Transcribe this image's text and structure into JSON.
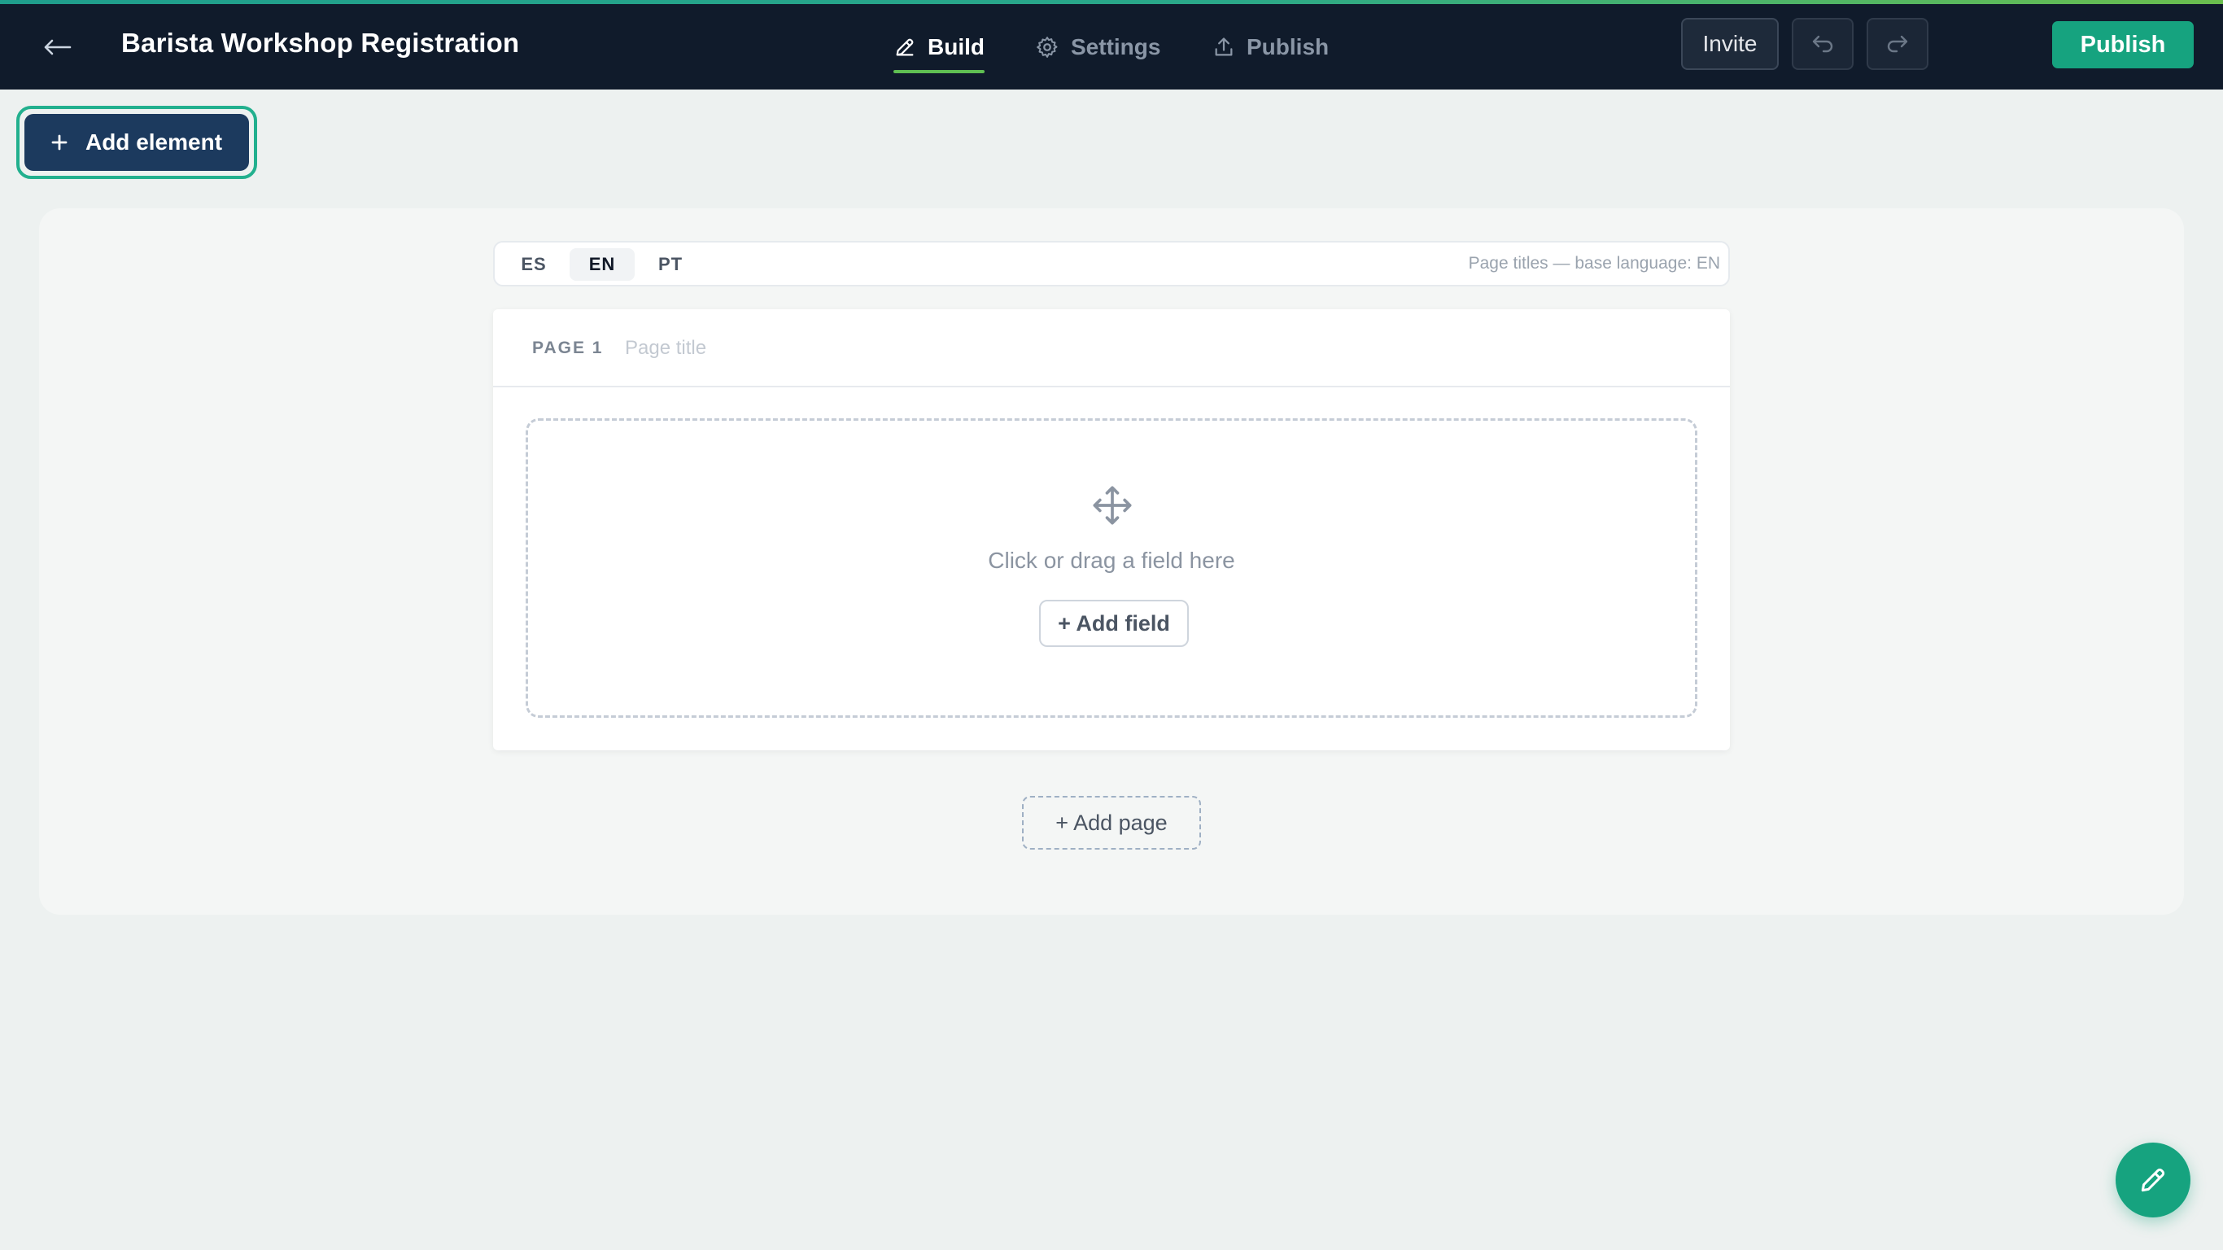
{
  "header": {
    "title": "Barista Workshop Registration",
    "tabs": [
      {
        "label": "Build",
        "icon": "pencil-icon",
        "active": true
      },
      {
        "label": "Settings",
        "icon": "gear-icon",
        "active": false
      },
      {
        "label": "Publish",
        "icon": "upload-icon",
        "active": false
      }
    ],
    "invite_label": "Invite",
    "publish_label": "Publish"
  },
  "toolbar": {
    "add_element_label": "Add element"
  },
  "languages": {
    "options": [
      "ES",
      "EN",
      "PT"
    ],
    "selected": "EN",
    "note": "Page titles — base language: EN"
  },
  "page": {
    "label": "PAGE 1",
    "title_value": "",
    "title_placeholder": "Page title",
    "dropzone_text": "Click or drag a field here",
    "add_field_label": "+ Add field"
  },
  "add_page_label": "+ Add page",
  "colors": {
    "header_bg": "#101b2b",
    "accent_green": "#16a37f",
    "active_tab_underline": "#5fbf52",
    "add_element_bg": "#1c3a5e",
    "add_element_focus_ring": "#22b08e"
  }
}
